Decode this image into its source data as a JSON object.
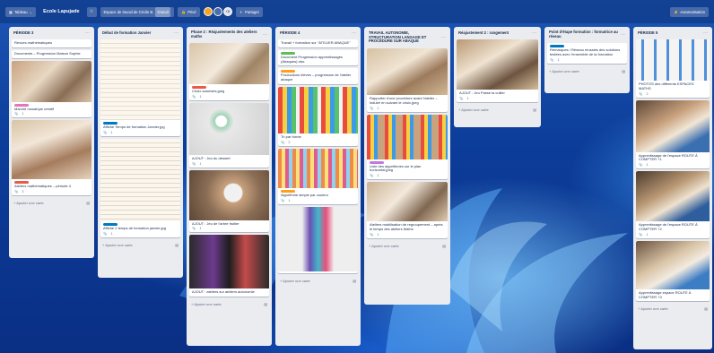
{
  "header": {
    "board_view": "Tableau",
    "board_title": "Ecole Lapujade",
    "workspace": "Espace de travail de Cécile B.",
    "workspace_badge": "Gratuit",
    "visibility": "Privé",
    "member_count": "+8",
    "share": "Partager",
    "automation": "Automatisation"
  },
  "lists": [
    {
      "title": "PÉRIODE 3",
      "cards": [
        {
          "title": "Revues mathématiques"
        },
        {
          "title": "Documents – Progression Maison Sophie"
        },
        {
          "title": "Marché mosaïque créatif",
          "badge": "1"
        },
        {
          "title": "Ateliers mathématiques – période 4",
          "badge": "3"
        }
      ],
      "add": "Ajouter une carte"
    },
    {
      "title": "Début de formation Janvier",
      "cards": [
        {
          "title": "Affiche Temps de formation Janvier.jpg",
          "badge": "1"
        },
        {
          "title": "Affiche 2 temps de formation janvier.jpg",
          "badge": "1"
        }
      ],
      "add": "Ajouter une carte"
    },
    {
      "title": "Phase 2 : Réajustements des ateliers maths",
      "cards": [
        {
          "title": "Choix autorisés.jpeg",
          "badge": "1"
        },
        {
          "title": "AJOUT : Jeu du dessert",
          "badge": "1"
        },
        {
          "title": "AJOUT : Jeu de l'arbre fruitier",
          "badge": "1"
        },
        {
          "title": "AJOUT : ateliers sur ateliers autonomie",
          "badge": "1"
        }
      ],
      "add": "Ajouter une carte"
    },
    {
      "title": "PÉRIODE 4",
      "cards": [
        {
          "title": "Travail + formation sur \"ATELIER ABAQUE\""
        },
        {
          "title": "Document Progression apprentissages (Abaques).xlsx"
        },
        {
          "title": "Productions élèves – progression de l'atelier abaque"
        },
        {
          "title": "Tri par forme",
          "badge": "2"
        },
        {
          "title": "Algorithme simple par couleur",
          "badge": "1"
        }
      ],
      "add": "Ajouter une carte"
    },
    {
      "title": "TRAVAIL AUTONOMIE, STRUCTURATION LANGAGE ET PROCÉDURE SUR ABAQUE",
      "cards": [
        {
          "title": "Rapporter d'une procédure avant l'atelier – induire en suivant le choix.jpeg",
          "badge": "1"
        },
        {
          "title": "Liste des algorithmes sur le plan horizontal.jpeg",
          "badge": "1"
        },
        {
          "title": "Ateliers mobilisation de regroupement – après le temps des ateliers Maths",
          "badge": "1"
        }
      ],
      "add": "Ajouter une carte"
    },
    {
      "title": "Réajustement 2 : rangement",
      "cards": [
        {
          "title": "AJOUT : Jeu Passe la cuiller",
          "badge": "1"
        }
      ],
      "add": "Ajouter une carte"
    },
    {
      "title": "Point d'étape formation : formatrice au réseau",
      "cards": [
        {
          "title": "Remarques / Réseau réussies des solutions testées avec l'ensemble de la formation",
          "badge": "1"
        }
      ],
      "add": "Ajouter une carte"
    },
    {
      "title": "PÉRIODE 5",
      "cards": [
        {
          "title": "PHOTOS des différents ESPACES MATHS",
          "badge": "2"
        },
        {
          "title": "Apprentissage de l'espace ROUTE À COMPTER +1",
          "badge": "1"
        },
        {
          "title": "Apprentissage de l'espace ROUTE À COMPTER +2",
          "badge": "1"
        },
        {
          "title": "Apprentissage espace ROUTE À COMPTER +3"
        }
      ],
      "add": "Ajouter une carte"
    }
  ],
  "colors": {
    "label_pink": "#e774bb",
    "label_blue": "#0079bf",
    "label_red": "#eb5a46",
    "label_orange": "#ff9f1a",
    "label_green": "#61bd4f",
    "label_purple": "#c377e0"
  }
}
